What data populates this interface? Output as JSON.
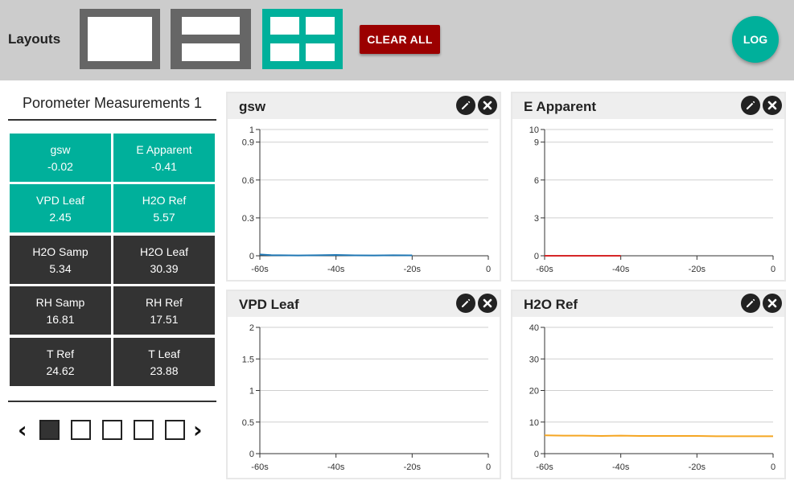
{
  "toolbar": {
    "title": "Layouts",
    "clear_all_label": "CLEAR ALL",
    "log_label": "LOG",
    "active_layout": "quad",
    "colors": {
      "accent": "#00b09b",
      "danger": "#9b0000",
      "inactive": "#666666"
    }
  },
  "panel": {
    "title": "Porometer Measurements 1",
    "tiles": [
      {
        "label": "gsw",
        "value": "-0.02",
        "selected": true
      },
      {
        "label": "E Apparent",
        "value": "-0.41",
        "selected": true
      },
      {
        "label": "VPD Leaf",
        "value": "2.45",
        "selected": true
      },
      {
        "label": "H2O Ref",
        "value": "5.57",
        "selected": true
      },
      {
        "label": "H2O Samp",
        "value": "5.34",
        "selected": false
      },
      {
        "label": "H2O Leaf",
        "value": "30.39",
        "selected": false
      },
      {
        "label": "RH Samp",
        "value": "16.81",
        "selected": false
      },
      {
        "label": "RH Ref",
        "value": "17.51",
        "selected": false
      },
      {
        "label": "T Ref",
        "value": "24.62",
        "selected": false
      },
      {
        "label": "T Leaf",
        "value": "23.88",
        "selected": false
      }
    ],
    "pager": {
      "prev_icon": "chevron-left-icon",
      "next_icon": "chevron-right-icon",
      "pages": 5,
      "current": 1
    }
  },
  "chart_data": [
    {
      "type": "line",
      "title": "gsw",
      "x": [
        -60,
        -55,
        -50,
        -45,
        -40,
        -35,
        -30,
        -25,
        -20,
        -15,
        -10,
        -5,
        0
      ],
      "x_ticks": [
        "-60s",
        "-40s",
        "-20s",
        "0"
      ],
      "y_ticks": [
        "0",
        "0.3",
        "0.6",
        "0.9",
        "1"
      ],
      "ylim": [
        0,
        1
      ],
      "series": [
        {
          "values": [
            0.01,
            0.005,
            0.002,
            0.004,
            0.006,
            0.003,
            0.002,
            0.004,
            0.003
          ],
          "x": [
            -60,
            -57,
            -50,
            -45,
            -40,
            -35,
            -30,
            -25,
            -20
          ],
          "color": "#1f77b4"
        }
      ]
    },
    {
      "type": "line",
      "title": "E Apparent",
      "x_ticks": [
        "-60s",
        "-40s",
        "-20s",
        "0"
      ],
      "y_ticks": [
        "0",
        "3",
        "6",
        "9",
        "10"
      ],
      "ylim": [
        0,
        10
      ],
      "series": [
        {
          "values": [
            0,
            0,
            0
          ],
          "x": [
            -60,
            -50,
            -40
          ],
          "color": "#d62728"
        }
      ]
    },
    {
      "type": "line",
      "title": "VPD Leaf",
      "x_ticks": [
        "-60s",
        "-40s",
        "-20s",
        "0"
      ],
      "y_ticks": [
        "0",
        "0.5",
        "1",
        "1.5",
        "2"
      ],
      "ylim": [
        0,
        2
      ],
      "series": []
    },
    {
      "type": "line",
      "title": "H2O Ref",
      "x_ticks": [
        "-60s",
        "-40s",
        "-20s",
        "0"
      ],
      "y_ticks": [
        "0",
        "10",
        "20",
        "30",
        "40"
      ],
      "ylim": [
        0,
        40
      ],
      "series": [
        {
          "values": [
            5.8,
            5.7,
            5.7,
            5.6,
            5.7,
            5.6,
            5.6,
            5.6,
            5.6,
            5.5,
            5.5,
            5.5,
            5.5
          ],
          "x": [
            -60,
            -55,
            -50,
            -45,
            -40,
            -35,
            -30,
            -25,
            -20,
            -15,
            -10,
            -5,
            0
          ],
          "color": "#f5a623"
        }
      ]
    }
  ]
}
